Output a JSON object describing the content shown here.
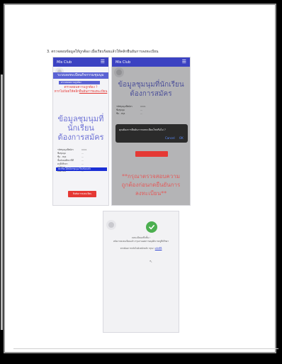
{
  "caption": "3. ตรวจสอบข้อมูลให้ถูกต้อง เมื่อเรียบร้อยแล้วให้คลิกยืนยันการลงทะเบียน",
  "screen1": {
    "app_name": "Mis Club",
    "banner": "ระบบลงทะเบียนกิจกรรมชุมนุม",
    "sub_banner": "ตรวจสอบความถูกต้อง",
    "check_line1": "ตรวจสอบความถูกต้อง ?",
    "check_line2a": "หากไม่ถ้อยให้คลิก",
    "check_link": "ยืนยันการลงทะเบียน",
    "title_line1": "ข้อมูลชุมนุมที่นักเรียน",
    "title_line2": "ต้องการสมัคร",
    "rows": [
      {
        "label": "รหัสชุมนุมที่สมัคร",
        "value": "0001"
      },
      {
        "label": "ชื่อชุมนุม",
        "value": "—"
      },
      {
        "label": "ชื่อ - สกุล",
        "value": "—"
      },
      {
        "label": "ชั้นมัธยมศึกษาปีที่",
        "value": "—"
      },
      {
        "label": "ครูที่ปรึกษา",
        "value": "—"
      },
      {
        "label": "ครูผู้ดูแล",
        "value": "—"
      },
      {
        "label": "ห้องเรียน",
        "value": "—"
      }
    ],
    "highlight_text": "นักเรียนได้สมัครชุมนุมเรียบร้อยแล้ว",
    "button_label": "ยืนยันการลงทะเบียน"
  },
  "screen2": {
    "app_name": "Mis Club",
    "title_line1": "ข้อมูลชุมนุมที่นักเรียน",
    "title_line2": "ต้องการสมัคร",
    "dialog_text": "คุณต้องการยืนยันการลงทะเบียนใช่หรือไม่ ?",
    "cancel_label": "Cancel",
    "ok_label": "OK",
    "warning_line1": "**กรุณาตรวจสอบความ",
    "warning_line2": "ถูกต้องก่อนกดยืนยันการ",
    "warning_line3": "ลงทะเบียน**"
  },
  "screen3": {
    "line1": "ลงทะเบียนเสร็จสิ้น !",
    "line2": "หลังจากลงทะเบียนแล้ว กรุณารอผลการอนุมัติจากครูที่ปรึกษา",
    "line3a": "หากต้องการกลับไปยังหน้าหลัก กรุณา",
    "line3_link": "คลิกที่นี่",
    "icon_checkmark": "check-circle-icon"
  },
  "colors": {
    "brand": "#3b42c2",
    "accent": "#6e73d6",
    "danger": "#e53935",
    "success": "#4caf50"
  }
}
